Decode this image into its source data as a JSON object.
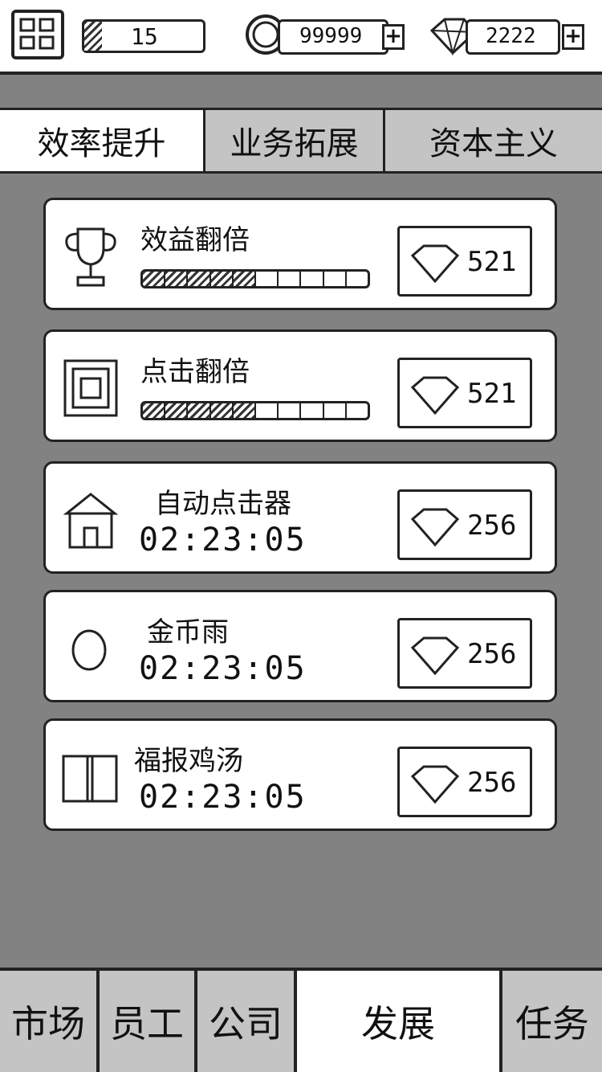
{
  "topbar": {
    "level": "15",
    "level_progress": 0.15,
    "coins": "99999",
    "gems": "2222",
    "add_symbol": "+"
  },
  "tabs": [
    {
      "label": "效率提升",
      "active": true
    },
    {
      "label": "业务拓展",
      "active": false
    },
    {
      "label": "资本主义",
      "active": false
    }
  ],
  "cards": [
    {
      "title": "效益翻倍",
      "icon": "trophy-icon",
      "progress_filled": 5,
      "progress_total": 10,
      "cost": "521"
    },
    {
      "title": "点击翻倍",
      "icon": "click-target-icon",
      "progress_filled": 5,
      "progress_total": 10,
      "cost": "521"
    },
    {
      "title": "自动点击器",
      "icon": "house-icon",
      "timer": "02:23:05",
      "cost": "256"
    },
    {
      "title": "金币雨",
      "icon": "coin-icon",
      "timer": "02:23:05",
      "cost": "256"
    },
    {
      "title": "福报鸡汤",
      "icon": "book-icon",
      "timer": "02:23:05",
      "cost": "256"
    }
  ],
  "bottom_nav": [
    {
      "label": "市场",
      "active": false
    },
    {
      "label": "员工",
      "active": false
    },
    {
      "label": "公司",
      "active": false
    },
    {
      "label": "发展",
      "active": true
    },
    {
      "label": "任务",
      "active": false
    }
  ]
}
